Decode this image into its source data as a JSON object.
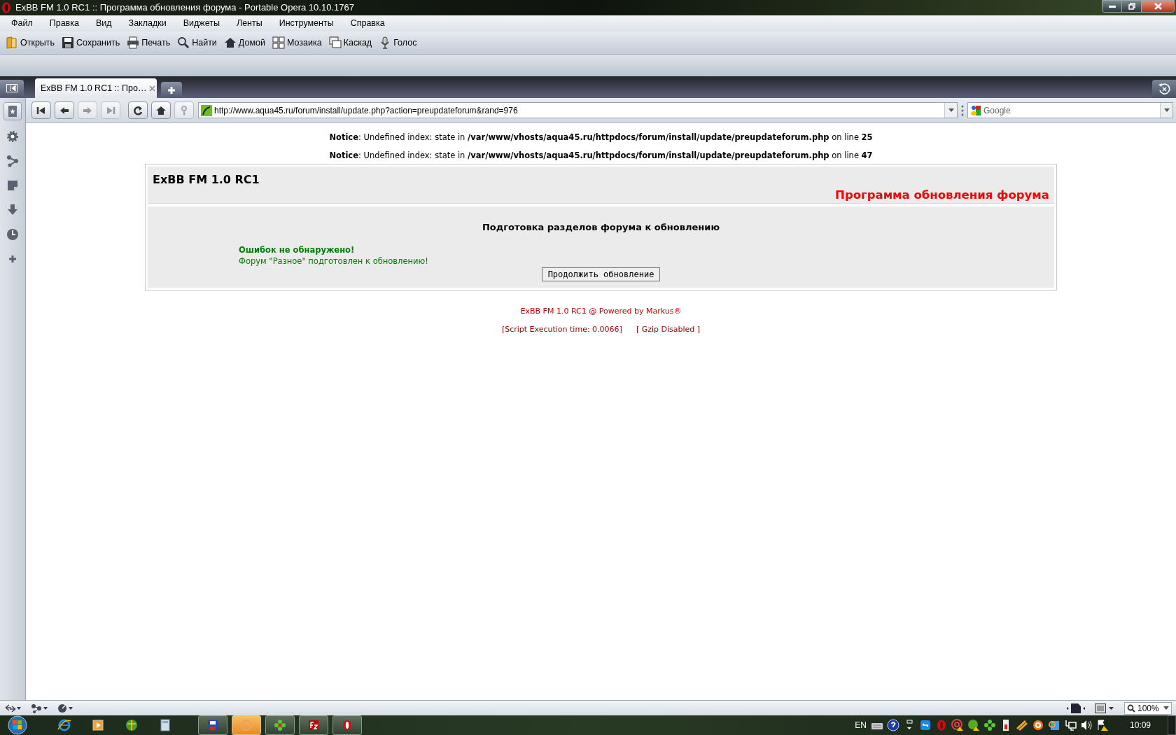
{
  "window": {
    "title": "ExBB FM 1.0 RC1 :: Программа обновления форума - Portable Opera 10.10.1767"
  },
  "menu": [
    "Файл",
    "Правка",
    "Вид",
    "Закладки",
    "Виджеты",
    "Ленты",
    "Инструменты",
    "Справка"
  ],
  "toolbar": [
    {
      "label": "Открыть",
      "kind": "open"
    },
    {
      "label": "Сохранить",
      "kind": "save"
    },
    {
      "label": "Печать",
      "kind": "print"
    },
    {
      "label": "Найти",
      "kind": "find"
    },
    {
      "label": "Домой",
      "kind": "home"
    },
    {
      "label": "Мозаика",
      "kind": "tile"
    },
    {
      "label": "Каскад",
      "kind": "cascade"
    },
    {
      "label": "Голос",
      "kind": "voice"
    }
  ],
  "tabs": [
    {
      "label": "ExBB FM 1.0 RC1 :: Про…",
      "selected": true
    }
  ],
  "address": {
    "value": "http://www.aqua45.ru/forum/install/update.php?action=preupdateforum&rand=976"
  },
  "search": {
    "placeholder": "Google"
  },
  "page": {
    "notices": [
      "**Notice**: Undefined index: state in **/var/www/vhosts/aqua45.ru/httpdocs/forum/install/update/preupdateforum.php** on line **25**",
      "**Notice**: Undefined index: state in **/var/www/vhosts/aqua45.ru/httpdocs/forum/install/update/preupdateforum.php** on line **47**"
    ],
    "title": "ExBB FM 1.0 RC1",
    "subtitle": "Программа обновления форума",
    "heading": "Подготовка разделов форума к обновлению",
    "status": "Ошибок не обнаружено!",
    "message": "Форум \"Разное\" подготовлен к обновлению!",
    "button": "Продолжить обновление",
    "footer": {
      "powered": "ExBB FM 1.0 RC1 @ Powered by Markus®",
      "time": "[Script Execution time: 0.0066]",
      "gzip": "[ Gzip Disabled ]"
    }
  },
  "status_bar": {
    "zoom": "100%"
  },
  "taskbar": {
    "language": "EN",
    "clock": "10:09"
  }
}
